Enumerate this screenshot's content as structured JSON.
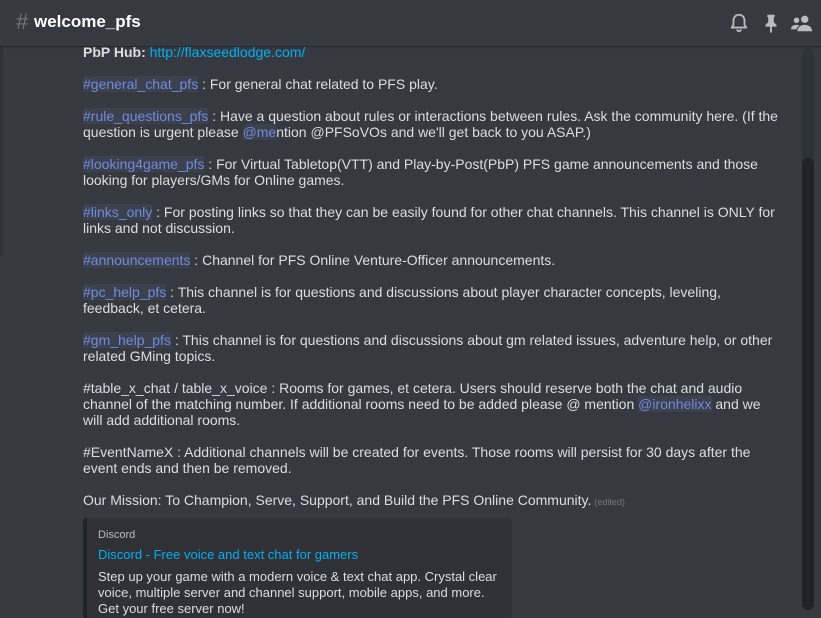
{
  "header": {
    "hash": "#",
    "channel_name": "welcome_pfs",
    "icons": [
      "bell-icon",
      "pin-icon",
      "members-icon"
    ]
  },
  "message": {
    "pbp": {
      "label": "PbP Hub:",
      "url": "http://flaxseedlodge.com/"
    },
    "general": {
      "channel": "#general_chat_pfs",
      "text": " : For general chat related to PFS play."
    },
    "rules": {
      "channel": "#rule_questions_pfs",
      "text_before": " : Have a question about rules or interactions between rules.  Ask the community here.  (If the question is urgent please ",
      "mention": "@me",
      "text_after": "ntion @PFSoVOs and we'll get back to you ASAP.)"
    },
    "looking": {
      "channel": "#looking4game_pfs",
      "text": " : For Virtual Tabletop(VTT) and Play-by-Post(PbP) PFS  game announcements and those looking for players/GMs for Online games."
    },
    "links": {
      "channel": "#links_only",
      "text": " : For posting links so that they can be easily found for other chat channels.  This channel is ONLY for links and not discussion."
    },
    "announcements": {
      "channel": "#announcements",
      "text": " : Channel for PFS Online Venture-Officer announcements."
    },
    "pc_help": {
      "channel": "#pc_help_pfs",
      "text": " : This channel is for questions and discussions about player character concepts, leveling, feedback, et cetera."
    },
    "gm_help": {
      "channel": "#gm_help_pfs",
      "text": " : This channel is for questions and discussions about gm related issues, adventure help, or other related GMing topics."
    },
    "table": {
      "text_before": "#table_x_chat / table_x_voice : Rooms for games, et cetera.  Users should reserve both the chat and audio channel of the matching number.  If additional rooms need to be added please @ mention ",
      "mention": "@ironhelixx",
      "text_after": " and we will add additional rooms."
    },
    "event": {
      "text": "#EventNameX : Additional channels will be created for events.  Those rooms will persist for 30 days after the event ends and then be removed."
    },
    "mission": {
      "text": "Our Mission: To Champion, Serve, Support, and Build the PFS Online Community.",
      "edited": "(edited)"
    }
  },
  "embed": {
    "provider": "Discord",
    "title": "Discord - Free voice and text chat for gamers",
    "description": "Step up your game with a modern voice & text chat app. Crystal clear voice, multiple server and channel support, mobile apps, and more. Get your free server now!"
  },
  "colors": {
    "background": "#36393f",
    "channel_mention": "#7289da",
    "link": "#00b0f4",
    "text": "#dcddde"
  }
}
